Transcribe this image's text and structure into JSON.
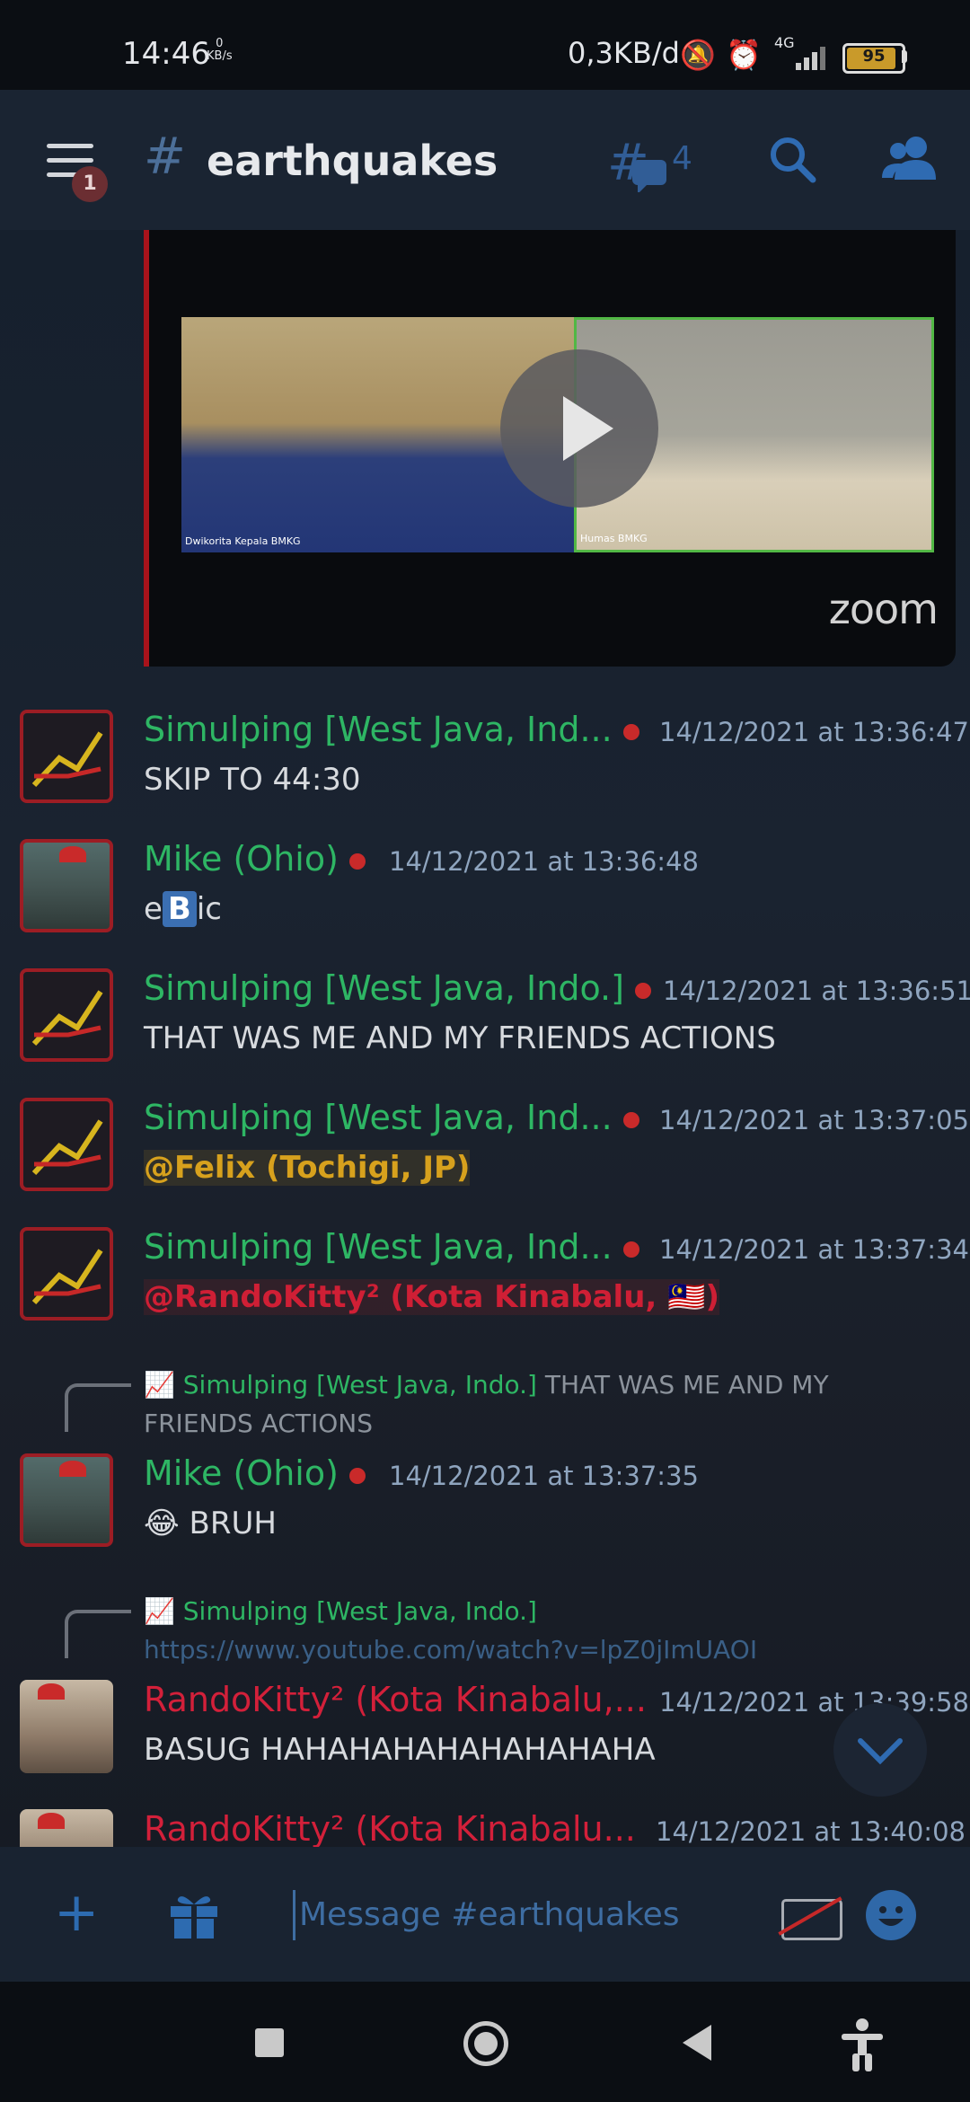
{
  "status_bar": {
    "time": "14:46",
    "kb_value": "0",
    "kb_unit": "KB/s",
    "net_speed": "0,3KB/d",
    "network": "4G",
    "battery": "95",
    "battery_level": 0.95
  },
  "header": {
    "unread_badge": "1",
    "hash": "#",
    "channel": "earthquakes",
    "threads_count": "4"
  },
  "embed": {
    "left_label": "Dwikorita Kepala BMKG",
    "right_label": "Humas BMKG",
    "brand": "zoom"
  },
  "messages": [
    {
      "author": "Simulping [West Java, Ind...",
      "time": "14/12/2021 at 13:36:47",
      "text": "SKIP TO 44:30"
    },
    {
      "author": "Mike (Ohio)",
      "time": "14/12/2021 at 13:36:48",
      "text_pre": "e",
      "text_box": "B",
      "text_post": "ic"
    },
    {
      "author": "Simulping [West Java, Indo.]",
      "time": "14/12/2021 at 13:36:51",
      "text": "THAT WAS ME AND MY FRIENDS ACTIONS"
    },
    {
      "author": "Simulping [West Java, Ind...",
      "time": "14/12/2021 at 13:37:05",
      "text": "@Felix (Tochigi, JP)"
    },
    {
      "author": "Simulping [West Java, Ind...",
      "time": "14/12/2021 at 13:37:34",
      "text": "@RandoKitty² (Kota Kinabalu, 🇲🇾)"
    },
    {
      "reply_name": "Simulping [West Java, Indo.]",
      "reply_text": "THAT WAS ME AND MY FRIENDS ACTIONS",
      "author": "Mike (Ohio)",
      "time": "14/12/2021 at 13:37:35",
      "text": "😂 BRUH"
    },
    {
      "reply_name": "Simulping [West Java, Indo.]",
      "reply_link": "https://www.youtube.com/watch?v=lpZ0jImUAOI",
      "author": "RandoKitty² (Kota Kinabalu,...",
      "time": "14/12/2021 at 13:39:58",
      "text": "BASUG HAHAHAHAHAHAHAHAHA"
    },
    {
      "author": "RandoKitty² (Kota Kinabalu...",
      "time": "14/12/2021 at 13:40:08"
    }
  ],
  "composer": {
    "placeholder": "Message #earthquakes"
  },
  "colors": {
    "accent": "#2d6bb0",
    "author_green": "#2eb664",
    "author_red": "#d3203a",
    "mention_gold": "#d7a11d"
  }
}
